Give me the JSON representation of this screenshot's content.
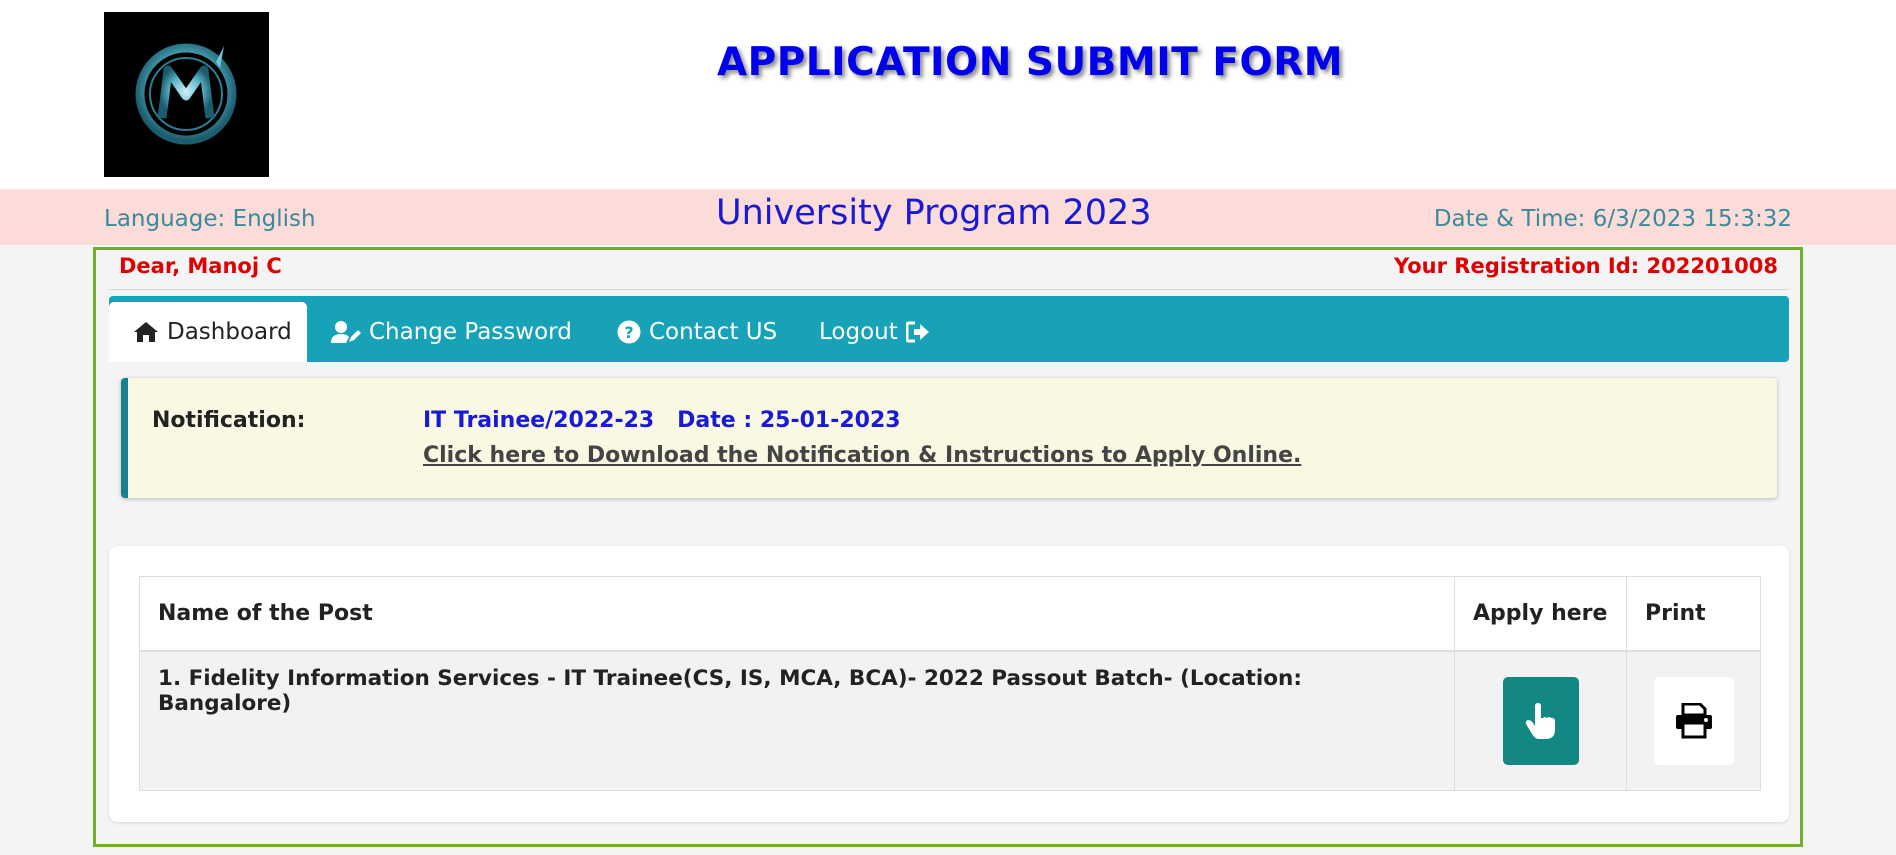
{
  "header": {
    "logo_text": "MC",
    "title": "APPLICATION SUBMIT FORM"
  },
  "subbar": {
    "language": "Language: English",
    "program": "University Program 2023",
    "datetime": "Date & Time: 6/3/2023 15:3:32"
  },
  "user": {
    "greeting": "Dear, Manoj C",
    "registration": "Your Registration Id: 202201008"
  },
  "nav": {
    "items": [
      {
        "label": "Dashboard",
        "icon": "home-icon",
        "active": true
      },
      {
        "label": "Change Password",
        "icon": "user-edit-icon",
        "active": false
      },
      {
        "label": "Contact US",
        "icon": "question-circle-icon",
        "active": false
      },
      {
        "label": "Logout",
        "icon": "sign-out-icon",
        "active": false
      }
    ]
  },
  "notification": {
    "label": "Notification:",
    "headline": "IT Trainee/2022-23   Date : 25-01-2023",
    "link": "Click here to Download the Notification & Instructions to Apply Online."
  },
  "table": {
    "headers": [
      "Name of the Post",
      "Apply here",
      "Print"
    ],
    "rows": [
      {
        "post": "1. Fidelity Information Services - IT Trainee(CS, IS, MCA, BCA)- 2022 Passout Batch- (Location: Bangalore)",
        "apply_icon": "hand-pointer-icon",
        "print_icon": "printer-icon"
      }
    ]
  },
  "colors": {
    "title": "#0000ee",
    "nav": "#17a2b8",
    "frame": "#6fae2e",
    "alert_red": "#e00000",
    "apply_button": "#138883"
  }
}
